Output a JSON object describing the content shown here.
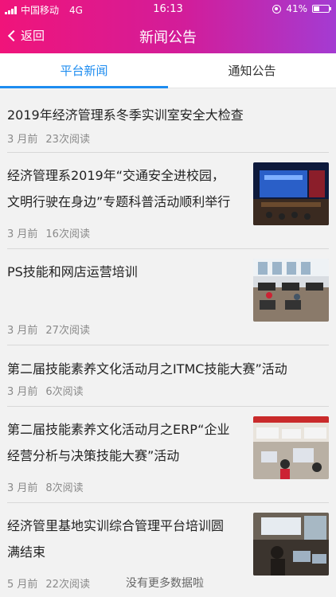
{
  "status": {
    "carrier": "中国移动",
    "network": "4G",
    "time": "16:13",
    "battery": "41%"
  },
  "nav": {
    "back_label": "返回",
    "title": "新闻公告"
  },
  "tabs": [
    {
      "label": "平台新闻",
      "active": true
    },
    {
      "label": "通知公告",
      "active": false
    }
  ],
  "articles": [
    {
      "title_lines": [
        "2019年经济管理系冬季实训室安全大检查"
      ],
      "age": "3 月前",
      "reads": "23次阅读",
      "has_thumb": false
    },
    {
      "title_lines": [
        "经济管理系2019年“交通安全进校园，",
        "文明行驶在身边”专题科普活动顺利举行"
      ],
      "age": "3 月前",
      "reads": "16次阅读",
      "has_thumb": true
    },
    {
      "title_lines": [
        "PS技能和网店运营培训"
      ],
      "age": "3 月前",
      "reads": "27次阅读",
      "has_thumb": true
    },
    {
      "title_lines": [
        "第二届技能素养文化活动月之ITMC技能大赛”活动"
      ],
      "age": "3 月前",
      "reads": "6次阅读",
      "has_thumb": false
    },
    {
      "title_lines": [
        "第二届技能素养文化活动月之ERP“企业",
        "经营分析与决策技能大赛”活动"
      ],
      "age": "3 月前",
      "reads": "8次阅读",
      "has_thumb": true
    },
    {
      "title_lines": [
        "经济管里基地实训综合管理平台培训圆",
        "满结束"
      ],
      "age": "5 月前",
      "reads": "22次阅读",
      "has_thumb": true
    }
  ],
  "footer": {
    "text": "没有更多数据啦"
  },
  "colors": {
    "header_start": "#f0147a",
    "header_end": "#a43bd2",
    "tab_active": "#1d8cf0"
  }
}
